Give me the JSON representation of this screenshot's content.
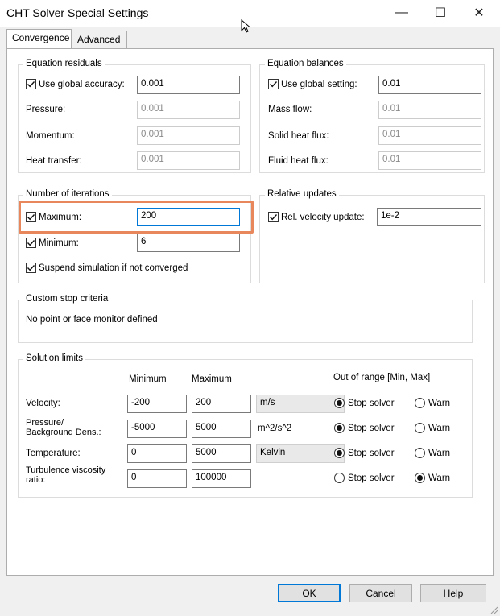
{
  "window": {
    "title": "CHT Solver Special Settings",
    "minimize": "—",
    "maximize": "☐",
    "close": "✕"
  },
  "tabs": [
    "Convergence",
    "Advanced"
  ],
  "equation_residuals": {
    "title": "Equation residuals",
    "use_global_label": "Use global accuracy:",
    "use_global_checked": true,
    "use_global_value": "0.001",
    "rows": [
      {
        "label": "Pressure:",
        "value": "0.001"
      },
      {
        "label": "Momentum:",
        "value": "0.001"
      },
      {
        "label": "Heat transfer:",
        "value": "0.001"
      }
    ]
  },
  "equation_balances": {
    "title": "Equation balances",
    "use_global_label": "Use global setting:",
    "use_global_checked": true,
    "use_global_value": "0.01",
    "rows": [
      {
        "label": "Mass flow:",
        "value": "0.01"
      },
      {
        "label": "Solid heat flux:",
        "value": "0.01"
      },
      {
        "label": "Fluid heat flux:",
        "value": "0.01"
      }
    ]
  },
  "iterations": {
    "title": "Number of iterations",
    "maximum_label": "Maximum:",
    "maximum_value": "200",
    "minimum_label": "Minimum:",
    "minimum_value": "6",
    "suspend_label": "Suspend simulation if not converged"
  },
  "relative_updates": {
    "title": "Relative updates",
    "velocity_label": "Rel. velocity update:",
    "velocity_value": "1e-2"
  },
  "custom_stop": {
    "title": "Custom stop criteria",
    "message": "No point or face monitor defined"
  },
  "solution_limits": {
    "title": "Solution limits",
    "col_min": "Minimum",
    "col_max": "Maximum",
    "col_range": "Out of range [Min, Max]",
    "stop_label": "Stop solver",
    "warn_label": "Warn",
    "rows": [
      {
        "label": "Velocity:",
        "min": "-200",
        "max": "200",
        "unit": "m/s",
        "selected": "stop"
      },
      {
        "label": "Pressure/\nBackground Dens.:",
        "min": "-5000",
        "max": "5000",
        "unit": "m^2/s^2",
        "selected": "stop"
      },
      {
        "label": "Temperature:",
        "min": "0",
        "max": "5000",
        "unit": "Kelvin",
        "selected": "stop"
      },
      {
        "label": "Turbulence viscosity\nratio:",
        "min": "0",
        "max": "100000",
        "unit": "",
        "selected": "warn"
      }
    ]
  },
  "buttons": {
    "ok": "OK",
    "cancel": "Cancel",
    "help": "Help"
  },
  "colors": {
    "highlight": "#e9875c",
    "default_button_border": "#0078d7"
  }
}
